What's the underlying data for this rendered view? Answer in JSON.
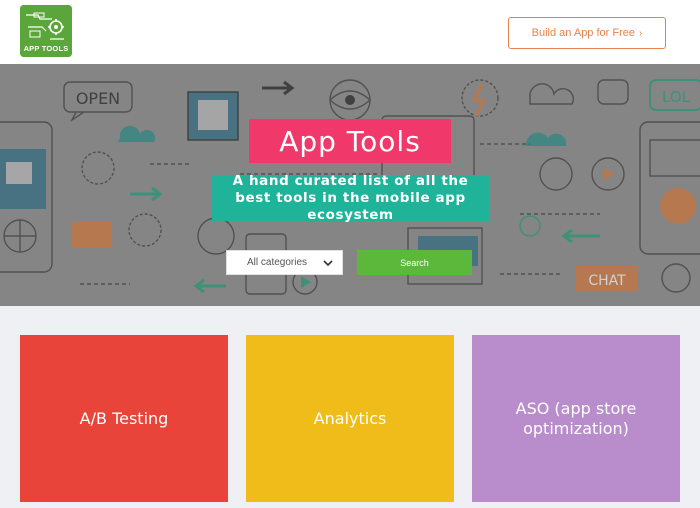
{
  "header": {
    "logo_text": "APP TOOLS",
    "cta_label": "Build an App for Free",
    "cta_chevron": "›"
  },
  "hero": {
    "title": "App Tools",
    "subtitle": "A hand curated list of all the best tools in the mobile app ecosystem",
    "select_value": "All categories",
    "search_label": "Search",
    "illustration_words": [
      "OPEN",
      "LOL",
      "CHAT"
    ]
  },
  "categories": [
    {
      "label": "A/B Testing",
      "color": "#e9443a"
    },
    {
      "label": "Analytics",
      "color": "#f0bc19"
    },
    {
      "label": "ASO (app store optimization)",
      "color": "#b98ccc"
    }
  ],
  "colors": {
    "accent": "#e8824a",
    "title_bg": "#f0386b",
    "subtitle_bg": "#1fb39a",
    "search_bg": "#5cb83a"
  }
}
